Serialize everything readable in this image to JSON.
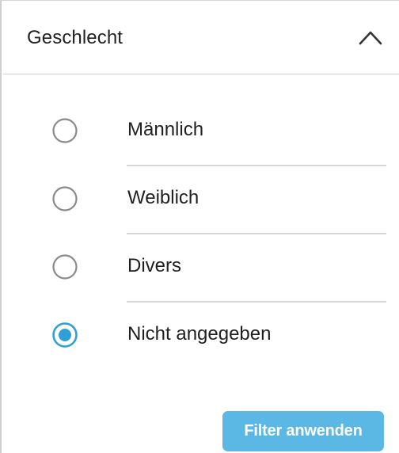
{
  "filter": {
    "title": "Geschlecht",
    "expanded": true,
    "toggle_icon": "chevron-up-icon",
    "options": [
      {
        "label": "Männlich",
        "selected": false
      },
      {
        "label": "Weiblich",
        "selected": false
      },
      {
        "label": "Divers",
        "selected": false
      },
      {
        "label": "Nicht angegeben",
        "selected": true
      }
    ],
    "apply_label": "Filter anwenden"
  },
  "colors": {
    "accent": "#2f9fd8",
    "button": "#5bb7e3",
    "radio_unselected": "#8a8a8a",
    "divider": "#d6d6d6"
  }
}
